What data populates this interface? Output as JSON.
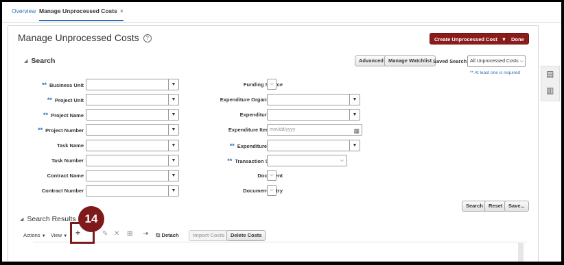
{
  "tabs": [
    {
      "label": "Overview"
    },
    {
      "label": "Manage Unprocessed Costs",
      "close": "×"
    }
  ],
  "page": {
    "title": "Manage Unprocessed Costs",
    "help": "?",
    "create_button": "Create Unprocessed Cost",
    "create_button_caret": "▼",
    "done_button": "Done"
  },
  "search": {
    "title": "Search",
    "advanced": "Advanced",
    "manage_watchlist": "Manage Watchlist",
    "saved_search_label": "Saved Search",
    "saved_search_value": "All Unprocessed Costs",
    "required_note": "** At least one is required",
    "left_fields": [
      {
        "label": "Business Unit",
        "required": "**"
      },
      {
        "label": "Project Unit",
        "required": "**"
      },
      {
        "label": "Project Name",
        "required": "**"
      },
      {
        "label": "Project Number",
        "required": "**"
      },
      {
        "label": "Task Name",
        "required": ""
      },
      {
        "label": "Task Number",
        "required": ""
      },
      {
        "label": "Contract Name",
        "required": ""
      },
      {
        "label": "Contract Number",
        "required": ""
      }
    ],
    "right_fields": [
      {
        "label": "Funding Source",
        "required": ""
      },
      {
        "label": "Expenditure Organization",
        "required": ""
      },
      {
        "label": "Expenditure Type",
        "required": ""
      },
      {
        "label": "Expenditure Item Date",
        "required": "",
        "placeholder": "mm/dd/yyyy"
      },
      {
        "label": "Expenditure Batch",
        "required": "**"
      },
      {
        "label": "Transaction Source",
        "required": "**"
      },
      {
        "label": "Document",
        "required": ""
      },
      {
        "label": "Document Entry",
        "required": ""
      }
    ],
    "buttons": {
      "search": "Search",
      "reset": "Reset",
      "save": "Save..."
    }
  },
  "results": {
    "title": "Search Results",
    "actions": "Actions",
    "view": "View",
    "detach": "Detach",
    "import_costs": "Import Costs",
    "delete_costs": "Delete Costs"
  },
  "callout": {
    "number": "14"
  },
  "colors": {
    "brand": "#8a1c1c",
    "link": "#2a6ebb"
  }
}
